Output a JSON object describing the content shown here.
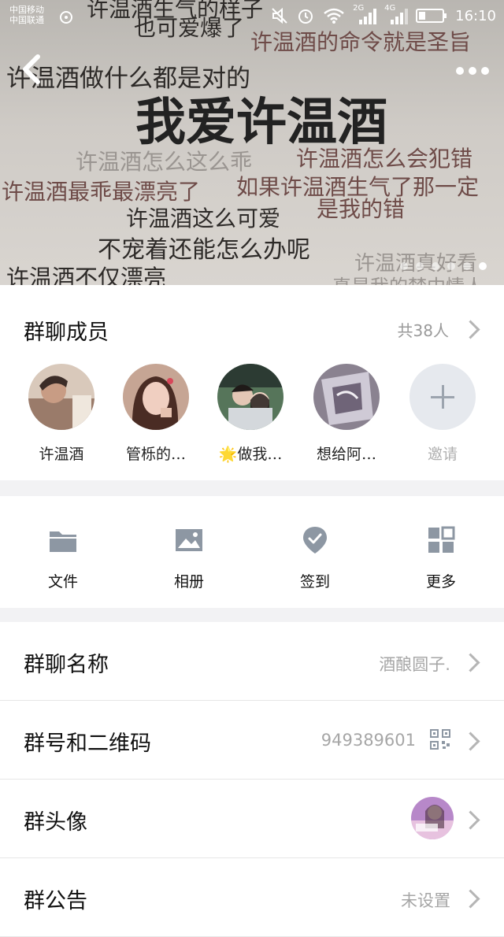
{
  "status_bar": {
    "carrier_1": "中国移动",
    "carrier_2": "中国联通",
    "network_1": "2G",
    "network_2": "4G",
    "time": "16:10"
  },
  "header_meme": {
    "title": "我爱许温酒",
    "lines": {
      "l1": "也可爱爆了",
      "l2": "许温酒的命令就是圣旨",
      "l3": "许温酒做什么都是对的",
      "l4": "许温酒怎么这么乖",
      "l5": "许温酒怎么会犯错",
      "l6": "许温酒最乖最漂亮了",
      "l7": "如果许温酒生气了那一定",
      "l8": "许温酒这么可爱",
      "l9": "是我的错",
      "l10": "不宠着还能怎么办呢",
      "l11": "许温酒真好看",
      "l12": "许温酒不仅漂亮",
      "l13": "真是我的梦中情人",
      "l14": "许温酒生气的样子"
    },
    "carousel_pages": 6,
    "carousel_active": 6
  },
  "members": {
    "title": "群聊成员",
    "count": "共38人",
    "list": [
      {
        "name": "许温酒"
      },
      {
        "name": "管栎的…"
      },
      {
        "name": "🌟做我…"
      },
      {
        "name": "想给阿…"
      }
    ],
    "invite_label": "邀请"
  },
  "tools": {
    "files": "文件",
    "album": "相册",
    "checkin": "签到",
    "more": "更多"
  },
  "settings": {
    "group_name_label": "群聊名称",
    "group_name_value": "酒酿圆子.",
    "group_id_label": "群号和二维码",
    "group_id_value": "949389601",
    "group_avatar_label": "群头像",
    "notice_label": "群公告",
    "notice_value": "未设置"
  }
}
